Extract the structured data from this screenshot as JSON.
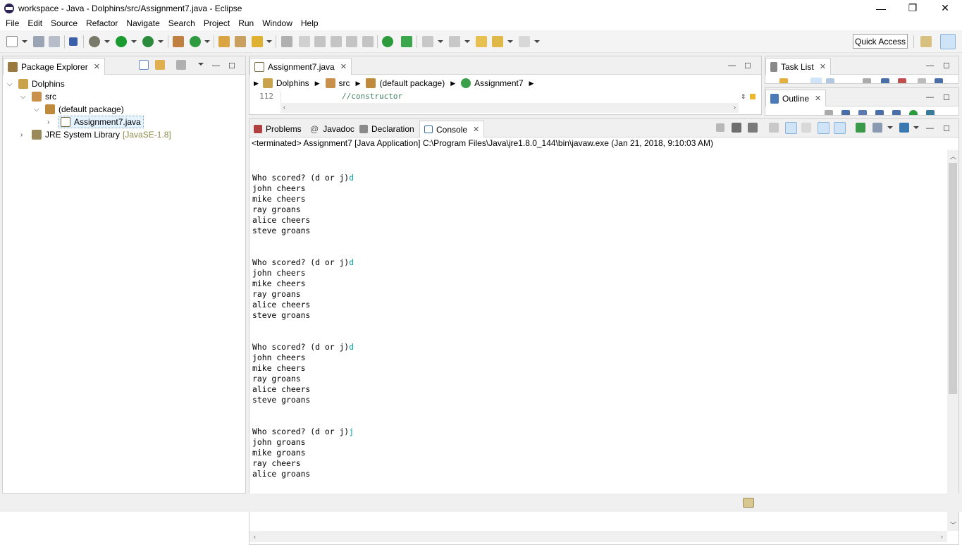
{
  "window": {
    "title": "workspace - Java - Dolphins/src/Assignment7.java - Eclipse",
    "minimize": "—",
    "restore": "❐",
    "close": "✕"
  },
  "menu": [
    "File",
    "Edit",
    "Source",
    "Refactor",
    "Navigate",
    "Search",
    "Project",
    "Run",
    "Window",
    "Help"
  ],
  "toolbar": {
    "quick_access": "Quick Access",
    "icons": [
      "new-icon",
      "save-icon",
      "save-all-icon",
      "skip-breakpoints-icon",
      "debug-icon",
      "run-icon",
      "external-tools-icon",
      "new-java-package-icon",
      "new-java-class-icon",
      "open-type-icon",
      "search-icon",
      "toggle-mark-occurrences-icon",
      "next-annotation-icon",
      "previous-annotation-icon",
      "last-edit-icon",
      "back-icon",
      "forward-icon",
      "open-perspective-icon",
      "java-perspective-icon"
    ]
  },
  "package_explorer": {
    "tab_label": "Package Explorer",
    "tree": {
      "project": "Dolphins",
      "src": "src",
      "package": "(default package)",
      "file": "Assignment7.java",
      "library": "JRE System Library",
      "library_version": "[JavaSE-1.8]"
    }
  },
  "editor": {
    "tab_label": "Assignment7.java",
    "breadcrumb": [
      "Dolphins",
      "src",
      "(default package)",
      "Assignment7"
    ],
    "line_number": "112",
    "line_text": "//constructor"
  },
  "task_list": {
    "tab_label": "Task List"
  },
  "outline": {
    "tab_label": "Outline"
  },
  "bottom_panel": {
    "tabs": [
      "Problems",
      "Javadoc",
      "Declaration",
      "Console"
    ],
    "active_tab": "Console",
    "javadoc_prefix": "@",
    "status_line": "<terminated> Assignment7 [Java Application] C:\\Program Files\\Java\\jre1.8.0_144\\bin\\javaw.exe (Jan 21, 2018, 9:10:03 AM)"
  },
  "console": {
    "blocks": [
      {
        "prompt": "Who scored? (d or j)",
        "input": "d",
        "lines": [
          "john cheers",
          "mike cheers",
          "ray groans",
          "alice cheers",
          "steve groans"
        ]
      },
      {
        "prompt": "Who scored? (d or j)",
        "input": "d",
        "lines": [
          "john cheers",
          "mike cheers",
          "ray groans",
          "alice cheers",
          "steve groans"
        ]
      },
      {
        "prompt": "Who scored? (d or j)",
        "input": "d",
        "lines": [
          "john cheers",
          "mike cheers",
          "ray groans",
          "alice cheers",
          "steve groans"
        ]
      },
      {
        "prompt": "Who scored? (d or j)",
        "input": "j",
        "lines": [
          "john groans",
          "mike groans",
          "ray cheers",
          "alice groans"
        ]
      }
    ]
  },
  "colors": {
    "console_input": "#00a0a0",
    "library_version": "#8b8b4b",
    "tab_bg": "#f0f0f0",
    "selection": "#e5f3ff"
  }
}
